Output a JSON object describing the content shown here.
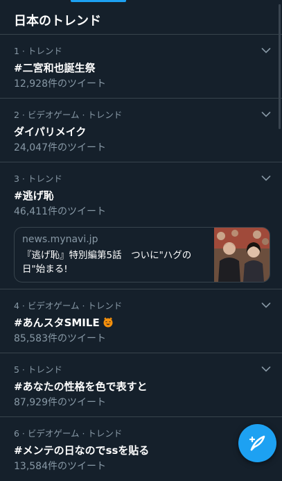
{
  "header": {
    "title": "日本のトレンド"
  },
  "trends": [
    {
      "meta": "1 · トレンド",
      "name": "#二宮和也誕生祭",
      "count": "12,928件のツイート"
    },
    {
      "meta": "2 · ビデオゲーム · トレンド",
      "name": "ダイパリメイク",
      "count": "24,047件のツイート"
    },
    {
      "meta": "3 · トレンド",
      "name": "#逃げ恥",
      "count": "46,411件のツイート",
      "card": {
        "domain": "news.mynavi.jp",
        "title": "『逃げ恥』特別編第5話　ついに\"ハグの日\"始まる!"
      }
    },
    {
      "meta": "4 · ビデオゲーム · トレンド",
      "name": "#あんスタSMILE",
      "count": "85,583件のツイート",
      "emoji": "smiling-cat-face-emoji"
    },
    {
      "meta": "5 · トレンド",
      "name": "#あなたの性格を色で表すと",
      "count": "87,929件のツイート"
    },
    {
      "meta": "6 · ビデオゲーム · トレンド",
      "name": "#メンテの日なのでssを貼る",
      "count": "13,584件のツイート"
    }
  ],
  "icons": {
    "more": "chevron-down-icon",
    "compose": "feather-quill-icon"
  },
  "colors": {
    "background": "#15202b",
    "accent": "#1da1f2",
    "secondary_text": "#8899a6",
    "divider": "#38444d"
  }
}
